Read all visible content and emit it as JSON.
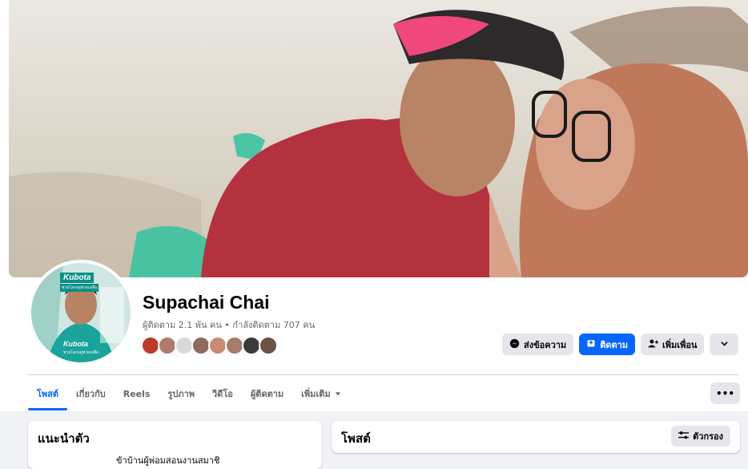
{
  "profile": {
    "name": "Supachai Chai",
    "stats": "ผู้ติดตาม 2.1 พัน คน • กำลังติดตาม 707 คน"
  },
  "avatar": {
    "brand": "Kubota",
    "slogan": "ช่วยโลกอยู่ช่วยเหลือ"
  },
  "friends": {
    "colors": [
      "#c0392b",
      "#b07b6a",
      "#d9d9d9",
      "#8e6b5a",
      "#c98a72",
      "#a67c6b",
      "#3d3a3a",
      "#6e5246"
    ]
  },
  "actions": {
    "message_label": "ส่งข้อความ",
    "follow_label": "ติดตาม",
    "add_friend_label": "เพิ่มเพื่อน"
  },
  "tabs": [
    {
      "label": "โพสต์"
    },
    {
      "label": "เกี่ยวกับ"
    },
    {
      "label": "Reels"
    },
    {
      "label": "รูปภาพ"
    },
    {
      "label": "วิดีโอ"
    },
    {
      "label": "ผู้ติดตาม"
    },
    {
      "label": "เพิ่มเติม"
    }
  ],
  "tab_more_label": "•••",
  "intro": {
    "title": "แนะนำตัว",
    "line": "ข้าบ้านผู้พ่อมสอนงานสมาชิ"
  },
  "posts": {
    "title": "โพสต์",
    "filter_label": "ตัวกรอง"
  },
  "colors": {
    "accent": "#0866ff",
    "button_gray": "#e4e6eb",
    "page_bg": "#f0f2f5"
  }
}
